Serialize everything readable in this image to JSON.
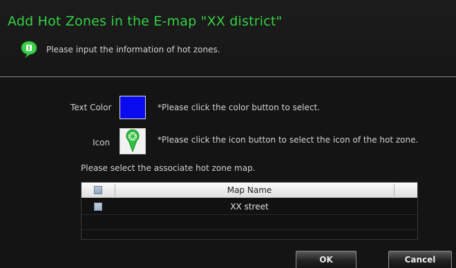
{
  "dialog": {
    "title": "Add Hot Zones in the E-map \"XX district\"",
    "hint": "Please input the information of hot zones."
  },
  "form": {
    "text_color_label": "Text Color",
    "text_color_value": "#0a0aee",
    "text_color_note": "*Please click the color button to select.",
    "icon_label": "Icon",
    "icon_name": "map-pin-icon",
    "icon_note": "*Please click the icon button to select the icon of the hot zone.",
    "map_select_label": "Please select the associate hot zone map."
  },
  "table": {
    "columns": [
      "Map Name"
    ],
    "rows": [
      {
        "map_name": "XX street",
        "checked": false
      }
    ],
    "select_all_checked": false
  },
  "buttons": {
    "ok": "OK",
    "cancel": "Cancel"
  },
  "colors": {
    "title_green": "#34d244",
    "background": "#141414"
  }
}
